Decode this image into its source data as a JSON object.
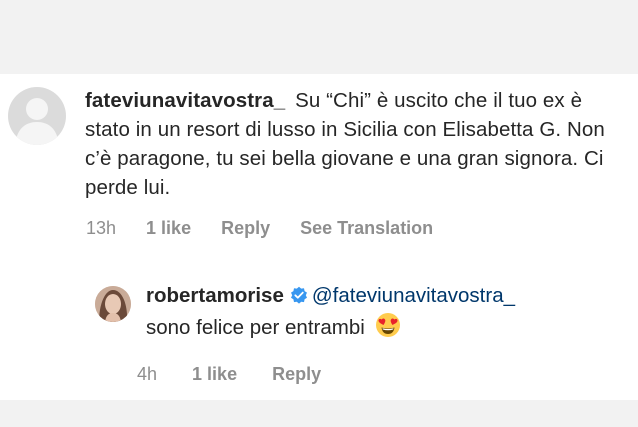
{
  "comment": {
    "username": "fateviunavitavostra_",
    "text": "Su “Chi” è uscito che il tuo ex è stato in un resort di lusso in Sicilia con Elisabetta G. Non c’è paragone, tu sei bella giovane e una gran signora. Ci perde lui.",
    "time": "13h",
    "likes": "1 like",
    "reply_label": "Reply",
    "translation_label": "See Translation"
  },
  "reply": {
    "username": "robertamorise",
    "mention": "@fateviunavitavostra_",
    "text": "sono felice per entrambi",
    "emoji": "heart-eyes-emoji",
    "time": "4h",
    "likes": "1 like",
    "reply_label": "Reply"
  },
  "colors": {
    "background": "#f2f2f2",
    "panel": "#ffffff",
    "text": "#262626",
    "meta": "#8e8e8e",
    "verified": "#3897f0",
    "mention": "#00376b"
  }
}
